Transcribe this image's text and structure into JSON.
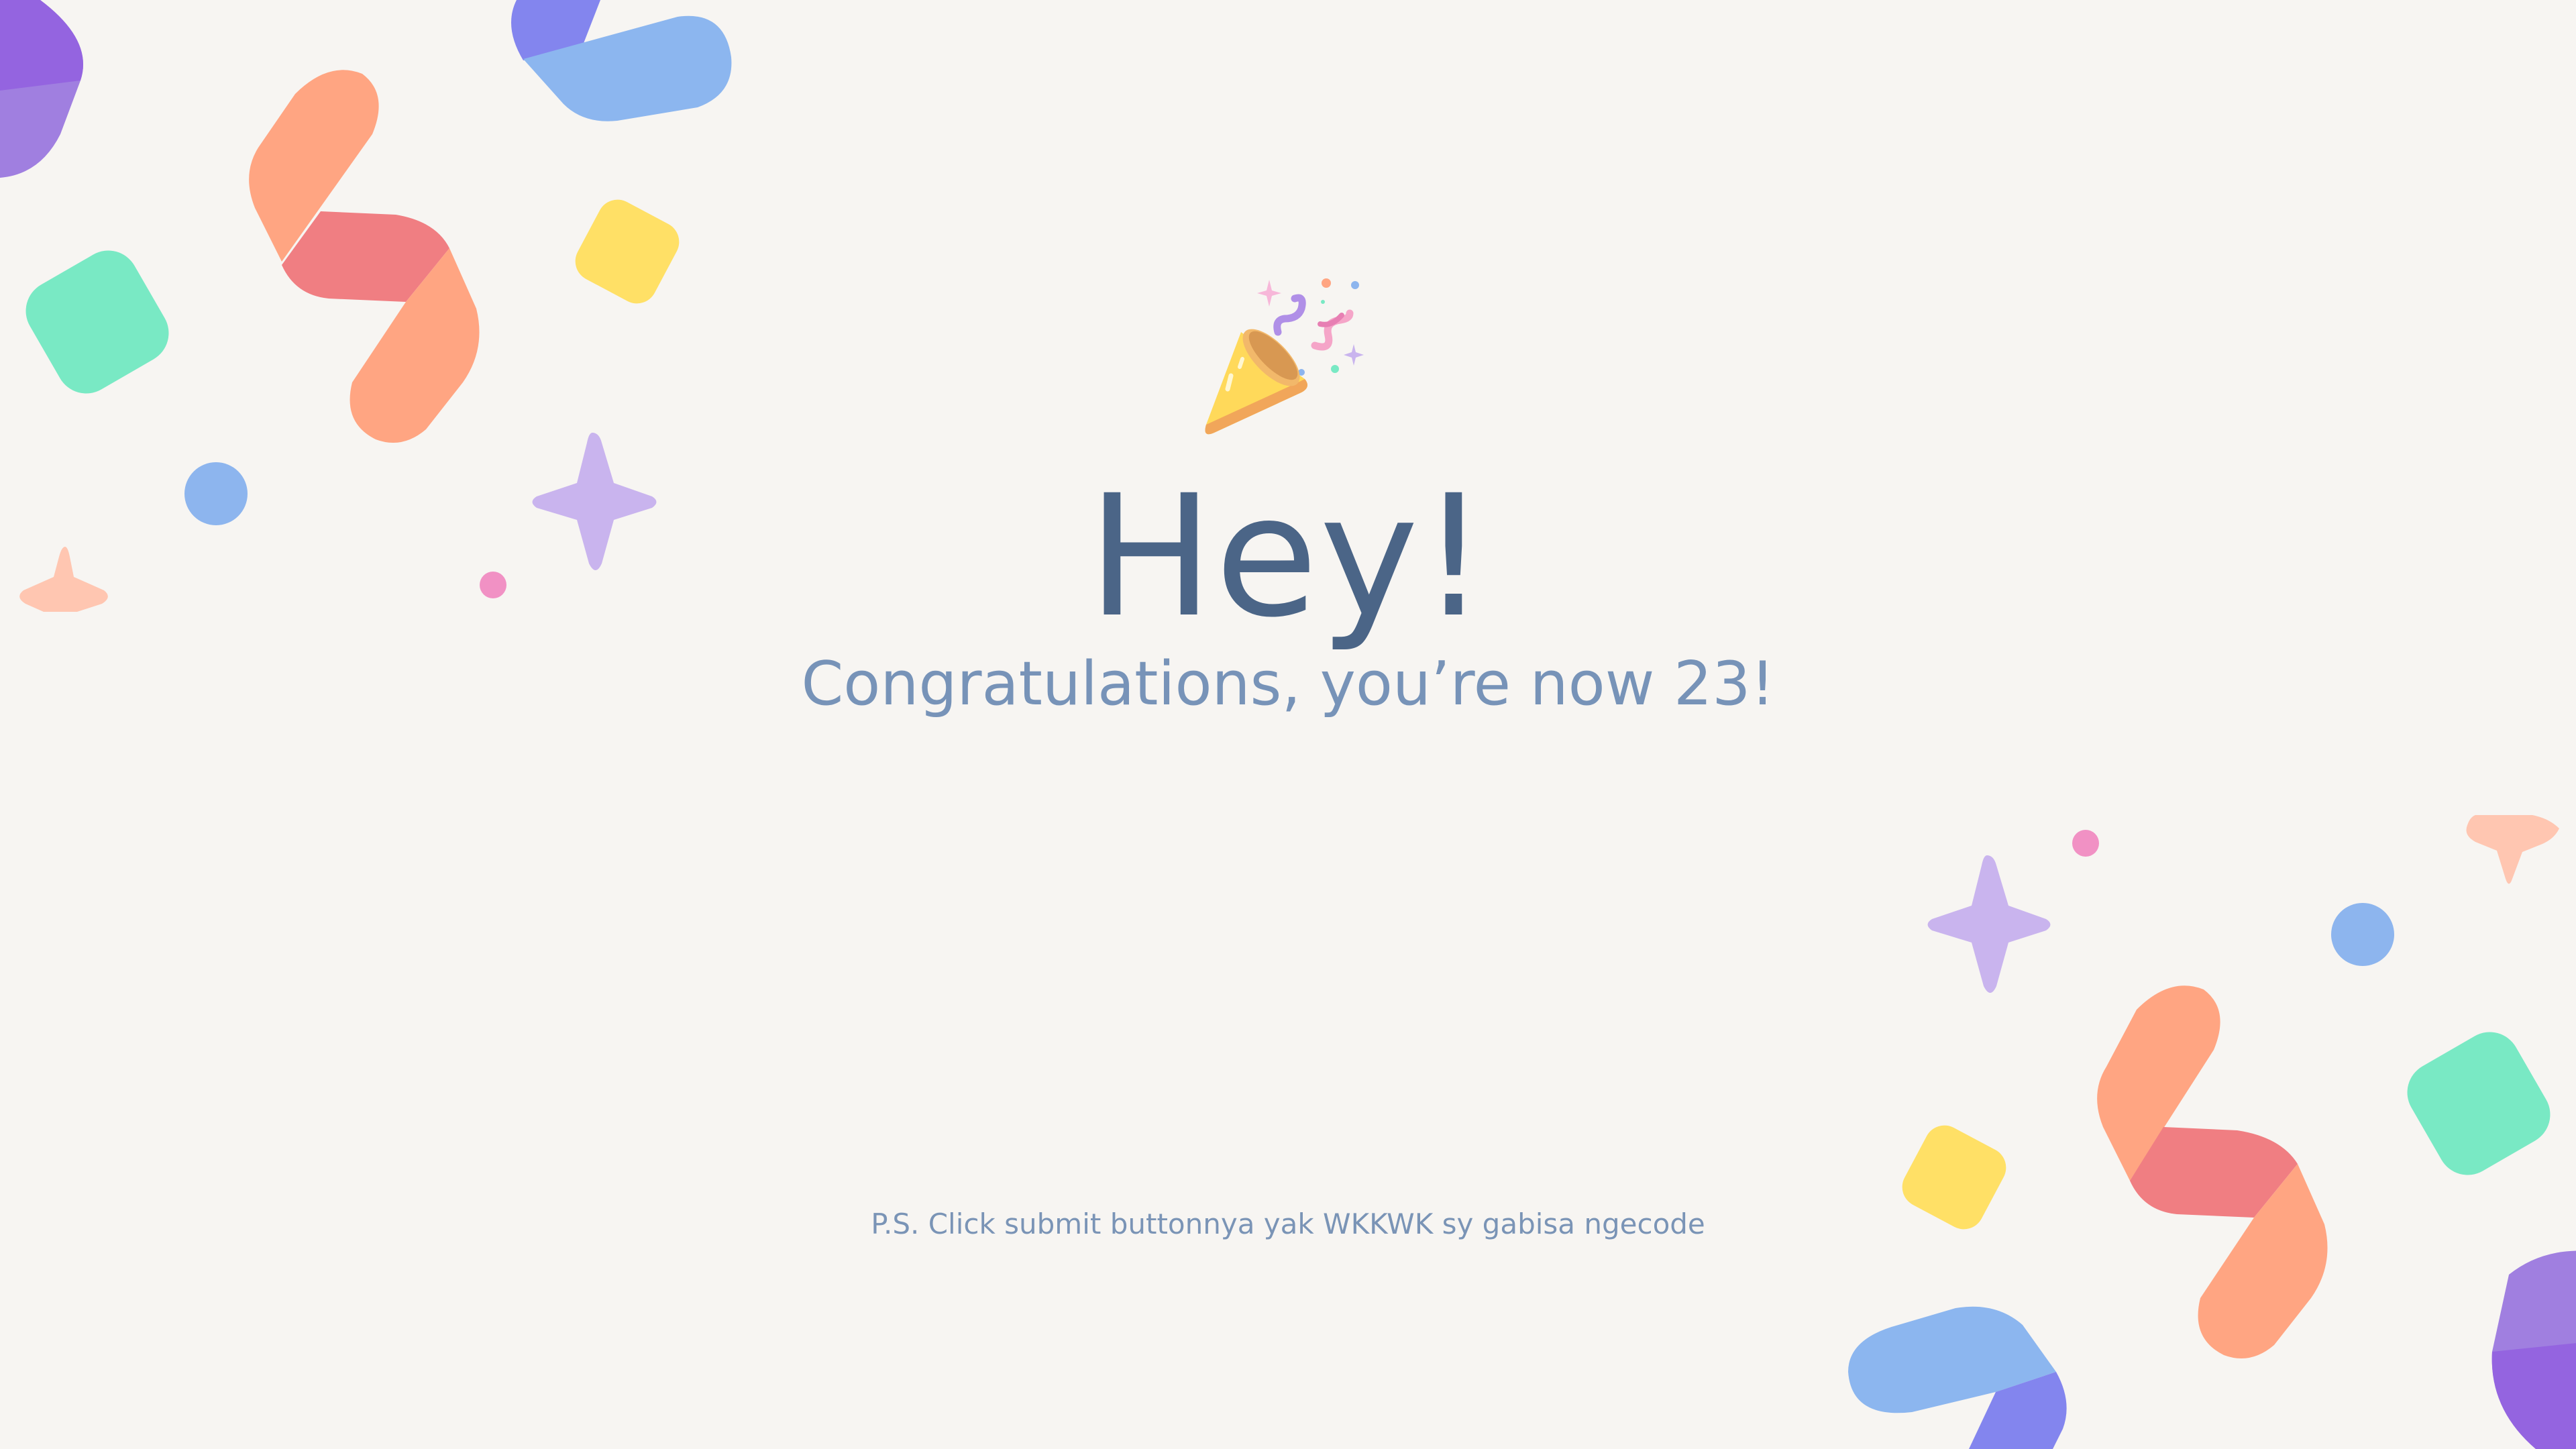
{
  "greeting": {
    "headline": "Hey!",
    "subheadline": "Congratulations, you’re now 23!",
    "footnote": "P.S. Click submit buttonnya yak WKKWK sy gabisa ngecode"
  },
  "icons": {
    "hero": "party-popper-icon"
  },
  "colors": {
    "background": "#f7f5f2",
    "headline": "#4b6587",
    "subheadline": "#7793b8",
    "footnote": "#7a94b6"
  }
}
